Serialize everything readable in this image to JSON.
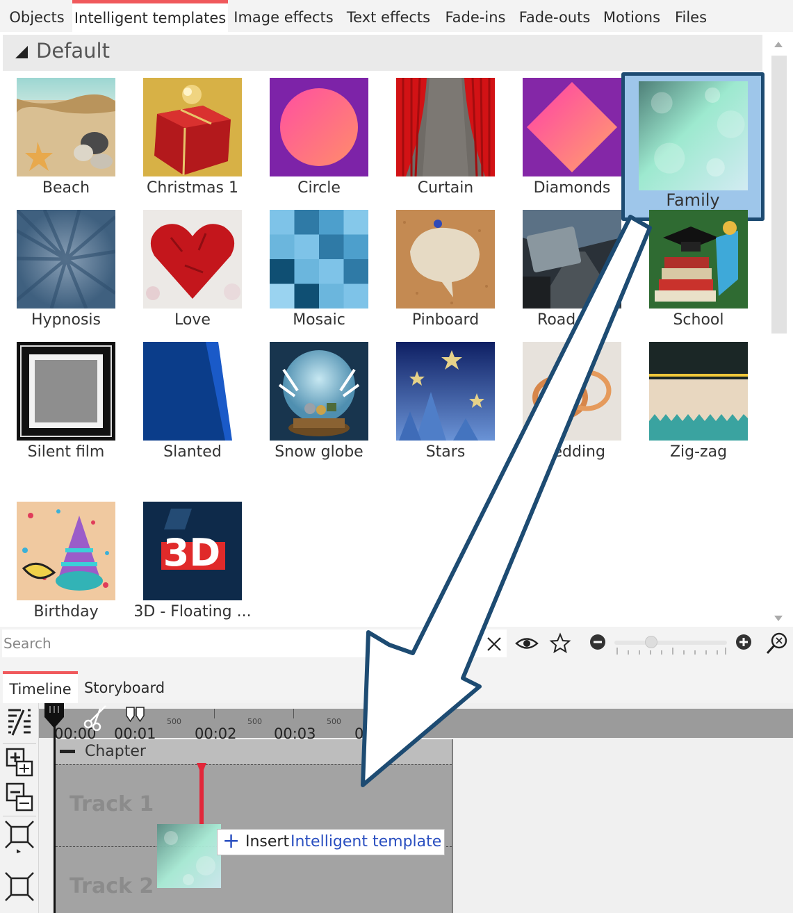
{
  "top_tabs": [
    "Objects",
    "Intelligent templates",
    "Image effects",
    "Text effects",
    "Fade-ins",
    "Fade-outs",
    "Motions",
    "Files"
  ],
  "active_top_tab": "Intelligent templates",
  "group": {
    "title": "Default"
  },
  "templates": [
    {
      "label": "Beach",
      "thumb": "beach"
    },
    {
      "label": "Christmas 1",
      "thumb": "gift"
    },
    {
      "label": "Circle",
      "thumb": "circle"
    },
    {
      "label": "Curtain",
      "thumb": "curtain"
    },
    {
      "label": "Diamonds",
      "thumb": "diamond"
    },
    {
      "label": "Family",
      "thumb": "bokeh",
      "selected": true
    },
    {
      "label": "Hypnosis",
      "thumb": "rays"
    },
    {
      "label": "Love",
      "thumb": "heart"
    },
    {
      "label": "Mosaic",
      "thumb": "mosaic"
    },
    {
      "label": "Pinboard",
      "thumb": "pinboard"
    },
    {
      "label": "Road trip",
      "thumb": "road"
    },
    {
      "label": "School",
      "thumb": "school"
    },
    {
      "label": "Silent film",
      "thumb": "frame"
    },
    {
      "label": "Slanted",
      "thumb": "slanted"
    },
    {
      "label": "Snow globe",
      "thumb": "snowglobe"
    },
    {
      "label": "Stars",
      "thumb": "stars"
    },
    {
      "label": "Wedding",
      "thumb": "rings"
    },
    {
      "label": "Zig-zag",
      "thumb": "zigzag"
    },
    {
      "label": "Birthday",
      "thumb": "party"
    },
    {
      "label": "3D - Floating ...",
      "thumb": "3d"
    }
  ],
  "search": {
    "placeholder": "Search",
    "value": ""
  },
  "toolbar_icons": [
    "close-icon",
    "eye-icon",
    "star-icon",
    "zoom-out-icon",
    "zoom-in-icon",
    "zoom-fit-icon"
  ],
  "bottom_tabs": [
    "Timeline",
    "Storyboard"
  ],
  "active_bottom_tab": "Timeline",
  "ruler": {
    "times": [
      "00:00",
      "00:01",
      "00:02",
      "00:03",
      "0"
    ],
    "minor_label": "500"
  },
  "chapter": {
    "title": "Chapter"
  },
  "tracks": [
    "Track 1",
    "Track 2"
  ],
  "insert_hint": {
    "word": "Insert",
    "target": "Intelligent template"
  },
  "colors": {
    "accent": "#f0595c",
    "selection_border": "#1d4b72",
    "selection_fill": "#9ec6ea",
    "link_blue": "#2a4fc0"
  }
}
